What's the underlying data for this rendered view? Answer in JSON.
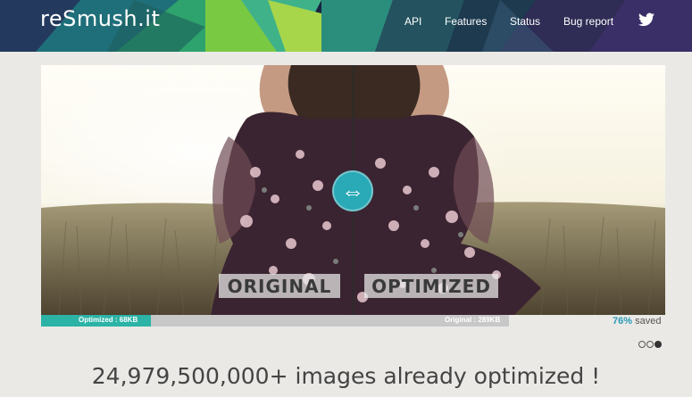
{
  "header": {
    "logo": "reSmush.it",
    "nav": [
      {
        "label": "API"
      },
      {
        "label": "Features"
      },
      {
        "label": "Status"
      },
      {
        "label": "Bug report"
      }
    ]
  },
  "compare": {
    "original_tag": "ORIGINAL",
    "optimized_tag": "OPTIMIZED",
    "handle_glyph": "⇔"
  },
  "sizebar": {
    "optimized_label": "Optimized : 68KB",
    "original_label": "Original : 289KB",
    "optimized_fraction": 0.235,
    "saved_pct": "76%",
    "saved_text": "saved"
  },
  "carousel": {
    "count": 3,
    "active_index": 2
  },
  "headline": {
    "count": "24,979,500,000+",
    "text": "images already optimized !"
  },
  "colors": {
    "accent": "#2aa9b6",
    "bar_fill": "#2bb3a6",
    "header_bg": "#1a2a4a"
  }
}
